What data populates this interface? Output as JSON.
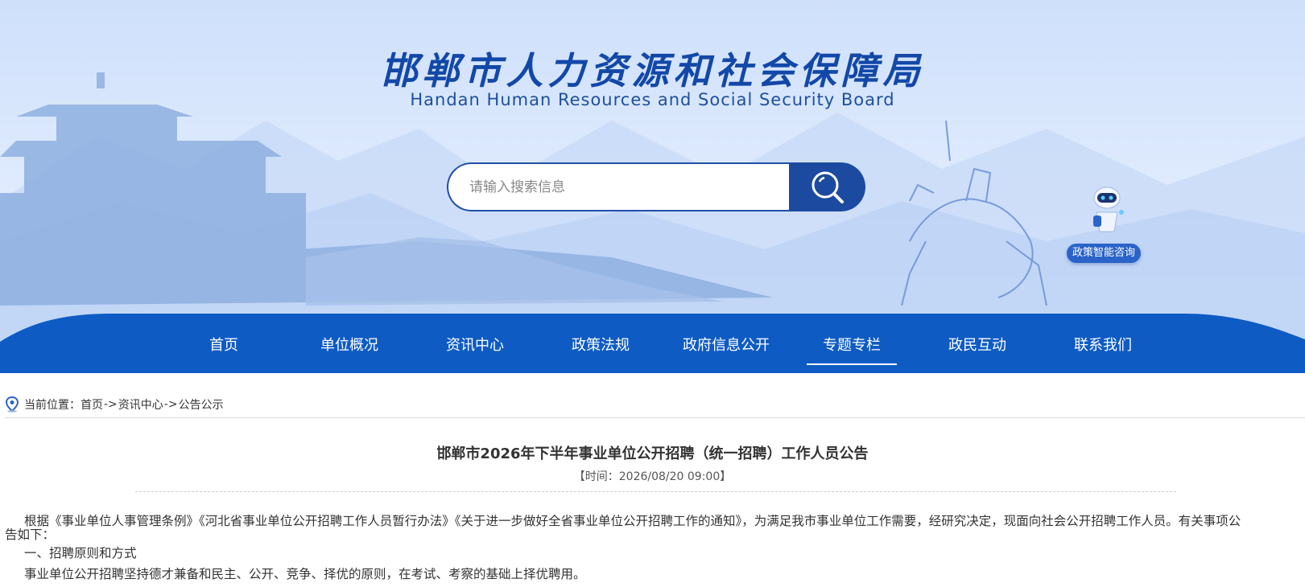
{
  "header": {
    "title": "邯郸市人力资源和社会保障局",
    "subtitle": "Handan Human Resources and Social Security Board"
  },
  "search": {
    "placeholder": "请输入搜索信息",
    "button_icon": "search-icon"
  },
  "assistant": {
    "label": "政策智能咨询",
    "icon": "robot-icon"
  },
  "nav": {
    "items": [
      {
        "label": "首页"
      },
      {
        "label": "单位概况"
      },
      {
        "label": "资讯中心"
      },
      {
        "label": "政策法规"
      },
      {
        "label": "政府信息公开"
      },
      {
        "label": "专题专栏",
        "active": true
      },
      {
        "label": "政民互动"
      },
      {
        "label": "联系我们"
      }
    ]
  },
  "breadcrumb": {
    "prefix": "当前位置：",
    "items": [
      "首页",
      "资讯中心",
      "公告公示"
    ],
    "separator": "->"
  },
  "article": {
    "title": "邯郸市2026年下半年事业单位公开招聘（统一招聘）工作人员公告",
    "time": "【时间：2026/08/20 09:00】",
    "paragraphs": [
      "根据《事业单位人事管理条例》《河北省事业单位公开招聘工作人员暂行办法》《关于进一步做好全省事业单位公开招聘工作的通知》，为满足我市事业单位工作需要，经研究决定，现面向社会公开招聘工作人员。有关事项公",
      "告如下：",
      "一、招聘原则和方式",
      "事业单位公开招聘坚持德才兼备和民主、公开、竞争、择优的原则，在考试、考察的基础上择优聘用。"
    ]
  },
  "colors": {
    "brand_blue": "#1c4aa0",
    "nav_blue": "#0e5bc4",
    "banner_light": "#dbe8fd"
  }
}
